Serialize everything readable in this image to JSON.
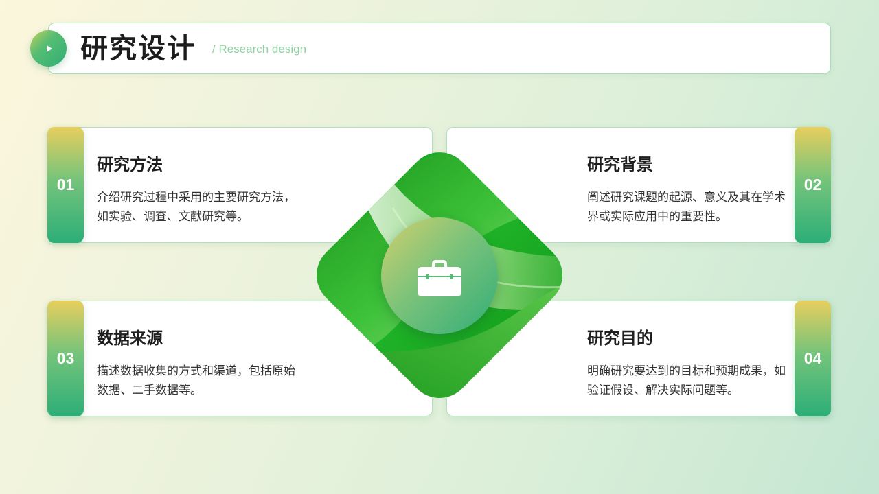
{
  "header": {
    "title": "研究设计",
    "subtitle": "/ Research design"
  },
  "cards": [
    {
      "num": "01",
      "title": "研究方法",
      "desc": "介绍研究过程中采用的主要研究方法，如实验、调查、文献研究等。"
    },
    {
      "num": "02",
      "title": "研究背景",
      "desc": "阐述研究课题的起源、意义及其在学术界或实际应用中的重要性。"
    },
    {
      "num": "03",
      "title": "数据来源",
      "desc": "描述数据收集的方式和渠道，包括原始数据、二手数据等。"
    },
    {
      "num": "04",
      "title": "研究目的",
      "desc": "明确研究要达到的目标和预期成果，如验证假设、解决实际问题等。"
    }
  ],
  "icons": {
    "header": "play-icon",
    "center": "briefcase-icon"
  },
  "colors": {
    "accent": "#2fae76",
    "accent_light": "#a9ddb6",
    "gold": "#e8ce5e",
    "green_dark": "#0c8f14"
  }
}
